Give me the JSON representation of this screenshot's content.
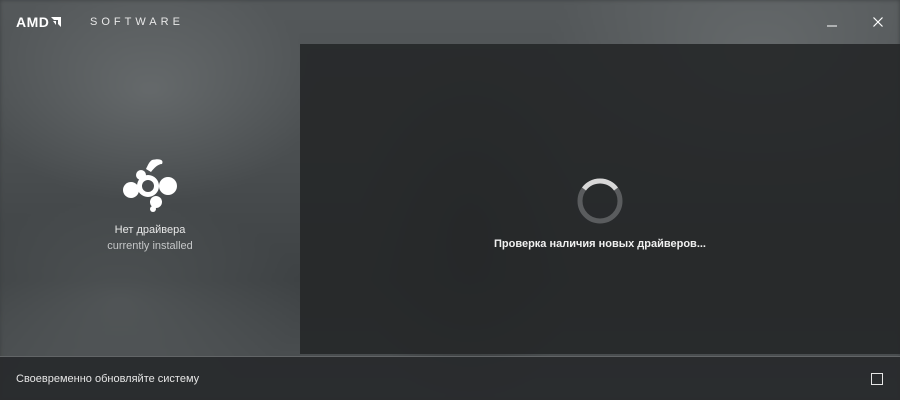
{
  "app": {
    "brand": "AMD",
    "name": "SOFTWARE"
  },
  "window_controls": {
    "minimize_icon": "minimize-icon",
    "close_icon": "close-icon"
  },
  "left_panel": {
    "icon": "amd-device-icon",
    "driver_title": "Нет драйвера",
    "driver_subtitle": "currently installed"
  },
  "main": {
    "spinner_icon": "loading-spinner-icon",
    "status": "Проверка наличия новых драйверов..."
  },
  "footer": {
    "label": "Своевременно обновляйте систему",
    "checkbox_checked": false
  },
  "colors": {
    "panel": "#262829",
    "text": "#ffffff",
    "spinner_track": "#5a5c5e",
    "spinner_arc": "#d8d8d8"
  }
}
